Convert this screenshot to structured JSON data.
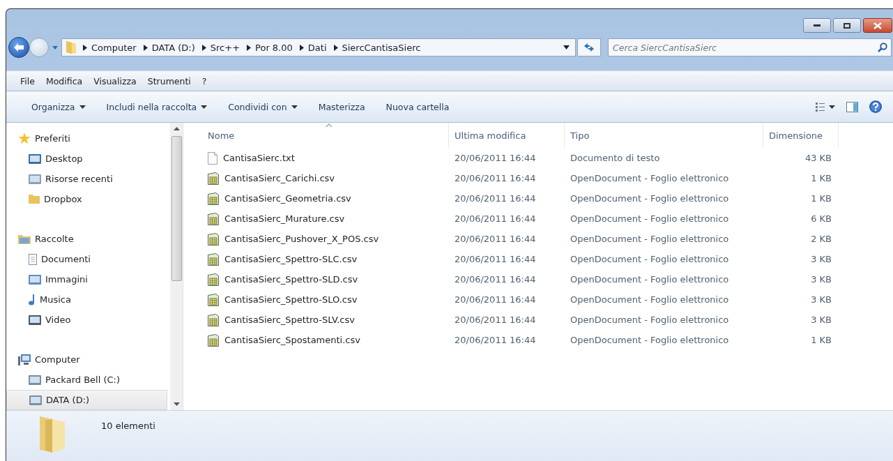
{
  "address": {
    "crumbs": [
      "Computer",
      "DATA (D:)",
      "Src++",
      "Por 8.00",
      "Dati",
      "SiercCantisaSierc"
    ]
  },
  "search": {
    "placeholder": "Cerca SiercCantisaSierc"
  },
  "menu": [
    "File",
    "Modifica",
    "Visualizza",
    "Strumenti",
    "?"
  ],
  "toolbar": [
    {
      "label": "Organizza",
      "dropdown": true
    },
    {
      "label": "Includi nella raccolta",
      "dropdown": true
    },
    {
      "label": "Condividi con",
      "dropdown": true
    },
    {
      "label": "Masterizza",
      "dropdown": false
    },
    {
      "label": "Nuova cartella",
      "dropdown": false
    }
  ],
  "sidebar": {
    "groups": [
      {
        "label": "Preferiti",
        "items": [
          {
            "label": "Desktop",
            "selected": false
          },
          {
            "label": "Risorse recenti",
            "selected": false
          },
          {
            "label": "Dropbox",
            "selected": false
          }
        ]
      },
      {
        "label": "Raccolte",
        "items": [
          {
            "label": "Documenti",
            "selected": false
          },
          {
            "label": "Immagini",
            "selected": false
          },
          {
            "label": "Musica",
            "selected": false
          },
          {
            "label": "Video",
            "selected": false
          }
        ]
      },
      {
        "label": "Computer",
        "items": [
          {
            "label": "Packard Bell (C:)",
            "selected": false
          },
          {
            "label": "DATA (D:)",
            "selected": true
          }
        ]
      }
    ]
  },
  "table": {
    "columns": [
      {
        "label": "Nome",
        "sorted": true
      },
      {
        "label": "Ultima modifica",
        "sorted": false
      },
      {
        "label": "Tipo",
        "sorted": false
      },
      {
        "label": "Dimensione",
        "sorted": false
      }
    ],
    "rows": [
      {
        "kind": "text",
        "name": "CantisaSierc.txt",
        "modified": "20/06/2011 16:44",
        "type": "Documento di testo",
        "size": "43 KB"
      },
      {
        "kind": "sheet",
        "name": "CantisaSierc_Carichi.csv",
        "modified": "20/06/2011 16:44",
        "type": "OpenDocument - Foglio elettronico",
        "size": "1 KB"
      },
      {
        "kind": "sheet",
        "name": "CantisaSierc_Geometria.csv",
        "modified": "20/06/2011 16:44",
        "type": "OpenDocument - Foglio elettronico",
        "size": "1 KB"
      },
      {
        "kind": "sheet",
        "name": "CantisaSierc_Murature.csv",
        "modified": "20/06/2011 16:44",
        "type": "OpenDocument - Foglio elettronico",
        "size": "6 KB"
      },
      {
        "kind": "sheet",
        "name": "CantisaSierc_Pushover_X_POS.csv",
        "modified": "20/06/2011 16:44",
        "type": "OpenDocument - Foglio elettronico",
        "size": "2 KB"
      },
      {
        "kind": "sheet",
        "name": "CantisaSierc_Spettro-SLC.csv",
        "modified": "20/06/2011 16:44",
        "type": "OpenDocument - Foglio elettronico",
        "size": "3 KB"
      },
      {
        "kind": "sheet",
        "name": "CantisaSierc_Spettro-SLD.csv",
        "modified": "20/06/2011 16:44",
        "type": "OpenDocument - Foglio elettronico",
        "size": "3 KB"
      },
      {
        "kind": "sheet",
        "name": "CantisaSierc_Spettro-SLO.csv",
        "modified": "20/06/2011 16:44",
        "type": "OpenDocument - Foglio elettronico",
        "size": "3 KB"
      },
      {
        "kind": "sheet",
        "name": "CantisaSierc_Spettro-SLV.csv",
        "modified": "20/06/2011 16:44",
        "type": "OpenDocument - Foglio elettronico",
        "size": "3 KB"
      },
      {
        "kind": "sheet",
        "name": "CantisaSierc_Spostamenti.csv",
        "modified": "20/06/2011 16:44",
        "type": "OpenDocument - Foglio elettronico",
        "size": "1 KB"
      }
    ]
  },
  "status_bar": {
    "count": "10 elementi"
  }
}
